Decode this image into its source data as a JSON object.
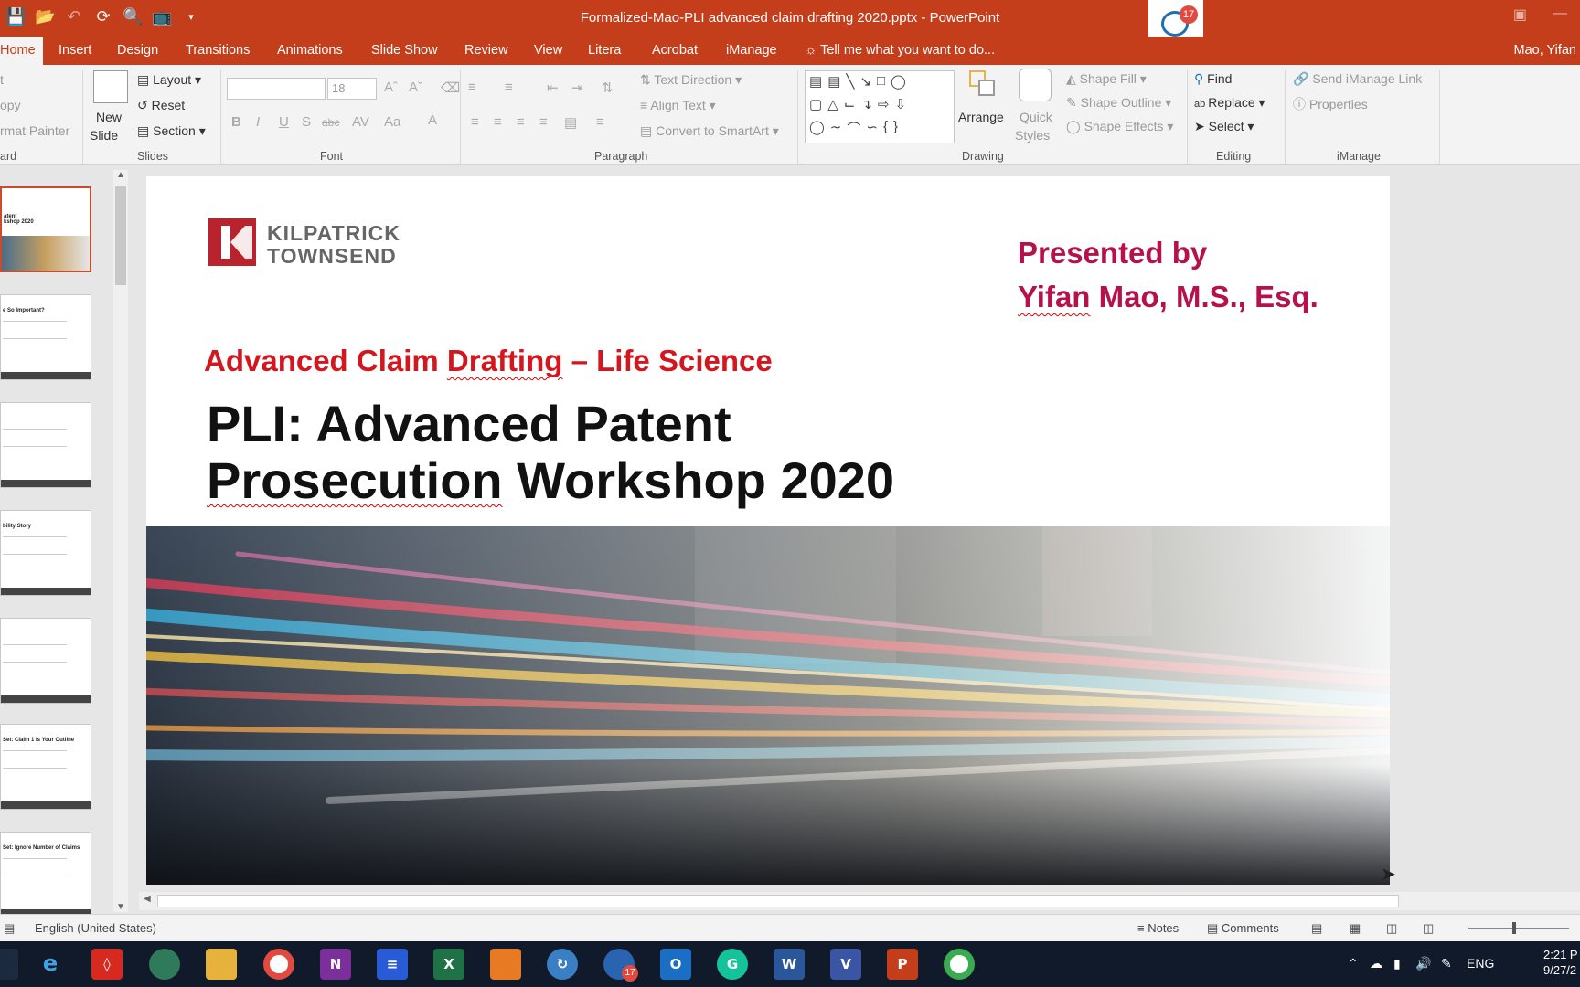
{
  "window": {
    "title": "Formalized-Mao-PLI advanced claim drafting 2020.pptx - PowerPoint",
    "notification_count": "17"
  },
  "tabs": [
    "Home",
    "Insert",
    "Design",
    "Transitions",
    "Animations",
    "Slide Show",
    "Review",
    "View",
    "Litera",
    "Acrobat",
    "iManage"
  ],
  "tell_me": "Tell me what you want to do...",
  "user_name": "Mao, Yifan",
  "ribbon": {
    "clipboard": {
      "cut": "t",
      "copy": "opy",
      "format_painter": "rmat Painter",
      "label": "ard"
    },
    "slides": {
      "new_slide": "New",
      "new_slide_2": "Slide",
      "layout": "Layout",
      "reset": "Reset",
      "section": "Section",
      "label": "Slides"
    },
    "font": {
      "font_size": "18",
      "label": "Font"
    },
    "paragraph": {
      "text_direction": "Text Direction",
      "align_text": "Align Text",
      "convert_smartart": "Convert to SmartArt",
      "label": "Paragraph"
    },
    "drawing": {
      "arrange": "Arrange",
      "quick": "Quick",
      "styles": "Styles",
      "shape_fill": "Shape Fill",
      "shape_outline": "Shape Outline",
      "shape_effects": "Shape Effects",
      "label": "Drawing"
    },
    "editing": {
      "find": "Find",
      "replace": "Replace",
      "select": "Select",
      "label": "Editing"
    },
    "imanage": {
      "send_link": "Send iManage Link",
      "properties": "Properties",
      "label": "iManage"
    }
  },
  "thumbnails": [
    {
      "title": "atent\nkshop 2020"
    },
    {
      "title": "e So Important?"
    },
    {
      "title": ""
    },
    {
      "title": "bility Story"
    },
    {
      "title": ""
    },
    {
      "title": "Set: Claim 1 Is Your Outline"
    },
    {
      "title": "Set: Ignore Number of Claims"
    }
  ],
  "slide": {
    "logo_line1": "KILPATRICK",
    "logo_line2": "TOWNSEND",
    "presented_by": "Presented by",
    "presenter_first": "Yifan",
    "presenter_rest": " Mao, M.S., Esq.",
    "subtitle_a": "Advanced Claim ",
    "subtitle_b": "Drafting",
    "subtitle_c": " – Life Science",
    "title_line1": "PLI: Advanced Patent",
    "title_line2a": "Prosecution",
    "title_line2b": " Workshop 2020"
  },
  "status": {
    "language": "English (United States)",
    "notes": "Notes",
    "comments": "Comments"
  },
  "taskbar": {
    "badge": "17",
    "language": "ENG",
    "time": "2:21 P",
    "date": "9/27/2"
  },
  "colors": {
    "accent": "#c43e1c",
    "title_red": "#d2171e",
    "presenter_magenta": "#b5124b",
    "logo_red": "#b8232d"
  }
}
